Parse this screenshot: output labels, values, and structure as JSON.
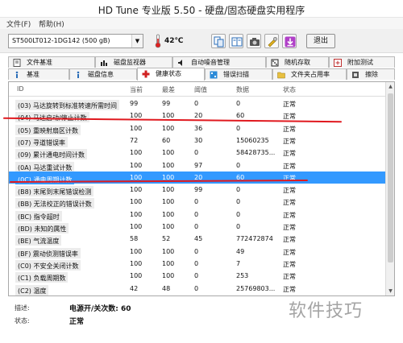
{
  "window": {
    "title": "HD Tune 专业版 5.50 - 硬盘/固态硬盘实用程序"
  },
  "menu": {
    "file": "文件(F)",
    "help": "帮助(H)"
  },
  "toolbar": {
    "drive": "ST500LT012-1DG142 (500 gB)",
    "temperature": "42℃",
    "exit_label": "退出",
    "icons": [
      "copy-icon",
      "copy-all-icon",
      "camera-icon",
      "options-icon",
      "download-icon"
    ]
  },
  "tabs_row1": [
    {
      "label": "文件基准",
      "icon": "file-bench-icon"
    },
    {
      "label": "磁盘监视器",
      "icon": "disk-monitor-icon"
    },
    {
      "label": "自动噪音管理",
      "icon": "noise-icon"
    },
    {
      "label": "随机存取",
      "icon": "random-access-icon"
    },
    {
      "label": "附加测试",
      "icon": "extra-tests-icon"
    }
  ],
  "tabs_row2": [
    {
      "label": "基准",
      "icon": "benchmark-icon"
    },
    {
      "label": "磁盘信息",
      "icon": "disk-info-icon"
    },
    {
      "label": "健康状态",
      "icon": "health-icon"
    },
    {
      "label": "错误扫描",
      "icon": "error-scan-icon"
    },
    {
      "label": "文件夹占用率",
      "icon": "folder-usage-icon"
    },
    {
      "label": "擦除",
      "icon": "erase-icon"
    }
  ],
  "table": {
    "columns": [
      "ID",
      "当前",
      "最差",
      "阈值",
      "数据",
      "状态"
    ],
    "rows": [
      {
        "id": "(03) 马达旋转到标准转速所需时间",
        "cur": "99",
        "worst": "99",
        "thr": "0",
        "data": "0",
        "status": "正常"
      },
      {
        "id": "(04) 马达启动/停止计数",
        "cur": "100",
        "worst": "100",
        "thr": "20",
        "data": "60",
        "status": "正常"
      },
      {
        "id": "(05) 重映射扇区计数",
        "cur": "100",
        "worst": "100",
        "thr": "36",
        "data": "0",
        "status": "正常"
      },
      {
        "id": "(07) 寻道错误率",
        "cur": "72",
        "worst": "60",
        "thr": "30",
        "data": "15060235",
        "status": "正常"
      },
      {
        "id": "(09) 累计通电时间计数",
        "cur": "100",
        "worst": "100",
        "thr": "0",
        "data": "58428735...",
        "status": "正常"
      },
      {
        "id": "(0A) 马达重试计数",
        "cur": "100",
        "worst": "100",
        "thr": "97",
        "data": "0",
        "status": "正常"
      },
      {
        "id": "(0C) 通电周期计数",
        "cur": "100",
        "worst": "100",
        "thr": "20",
        "data": "60",
        "status": "正常",
        "selected": true
      },
      {
        "id": "(B8) 末尾到末尾错误检测",
        "cur": "100",
        "worst": "100",
        "thr": "99",
        "data": "0",
        "status": "正常"
      },
      {
        "id": "(BB) 无法校正的错误计数",
        "cur": "100",
        "worst": "100",
        "thr": "0",
        "data": "0",
        "status": "正常"
      },
      {
        "id": "(BC) 指令超时",
        "cur": "100",
        "worst": "100",
        "thr": "0",
        "data": "0",
        "status": "正常"
      },
      {
        "id": "(BD) 未知的属性",
        "cur": "100",
        "worst": "100",
        "thr": "0",
        "data": "0",
        "status": "正常"
      },
      {
        "id": "(BE) 气流温度",
        "cur": "58",
        "worst": "52",
        "thr": "45",
        "data": "772472874",
        "status": "正常"
      },
      {
        "id": "(BF) 震动侦测错误率",
        "cur": "100",
        "worst": "100",
        "thr": "0",
        "data": "49",
        "status": "正常"
      },
      {
        "id": "(C0) 不安全关闭计数",
        "cur": "100",
        "worst": "100",
        "thr": "0",
        "data": "7",
        "status": "正常"
      },
      {
        "id": "(C1) 负载周期数",
        "cur": "100",
        "worst": "100",
        "thr": "0",
        "data": "253",
        "status": "正常"
      },
      {
        "id": "(C2) 温度",
        "cur": "42",
        "worst": "48",
        "thr": "0",
        "data": "25769803...",
        "status": "正常"
      }
    ]
  },
  "details": {
    "desc_label": "描述:",
    "desc_value": "电源开/关次数:  60",
    "status_label": "状态:",
    "status_value": "正常"
  },
  "watermark": "软件技巧",
  "colors": {
    "selection": "#3399ff",
    "annotation": "#e0191f"
  }
}
